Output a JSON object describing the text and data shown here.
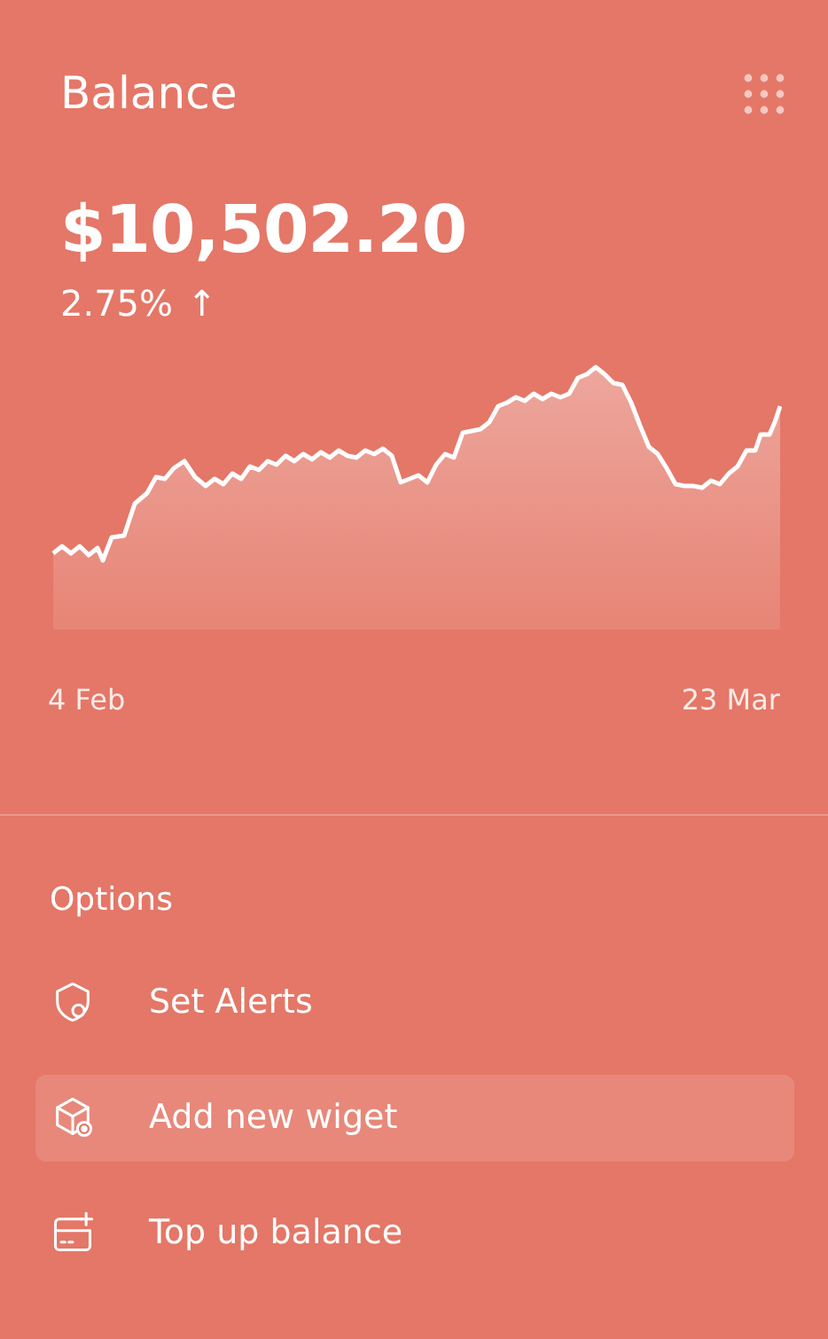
{
  "card": {
    "title": "Balance",
    "amount": "$10,502.20",
    "change": "2.75%",
    "arrow": "↑"
  },
  "chart": {
    "x_start": "4 Feb",
    "x_end": "23 Mar"
  },
  "options": {
    "heading": "Options",
    "items": [
      {
        "label": "Set Alerts",
        "kind": "alert",
        "selected": false
      },
      {
        "label": "Add new wiget",
        "kind": "widget",
        "selected": true
      },
      {
        "label": "Top up balance",
        "kind": "topup",
        "selected": false
      }
    ]
  }
}
